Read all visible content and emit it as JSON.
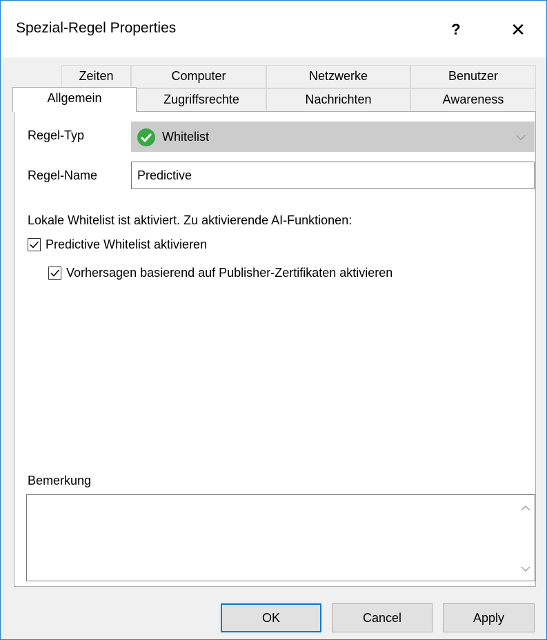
{
  "window": {
    "title": "Spezial-Regel Properties",
    "help_label": "?",
    "close_label": "✕",
    "accent_color": "#0078d7"
  },
  "tabs": {
    "row1": [
      "Zeiten",
      "Computer",
      "Netzwerke",
      "Benutzer"
    ],
    "row2": [
      "Allgemein",
      "Zugriffsrechte",
      "Nachrichten",
      "Awareness"
    ],
    "active": "Allgemein"
  },
  "form": {
    "regel_typ_label": "Regel-Typ",
    "regel_typ_value": "Whitelist",
    "regel_typ_icon": "green-check-icon",
    "regel_name_label": "Regel-Name",
    "regel_name_value": "Predictive",
    "info_text": "Lokale Whitelist ist aktiviert. Zu aktivierende AI-Funktionen:",
    "checkbox1_label": "Predictive Whitelist aktivieren",
    "checkbox1_checked": true,
    "checkbox2_label": "Vorhersagen basierend auf Publisher-Zertifikaten aktivieren",
    "checkbox2_checked": true,
    "remark_label": "Bemerkung",
    "remark_value": ""
  },
  "buttons": {
    "ok": "OK",
    "cancel": "Cancel",
    "apply": "Apply"
  }
}
